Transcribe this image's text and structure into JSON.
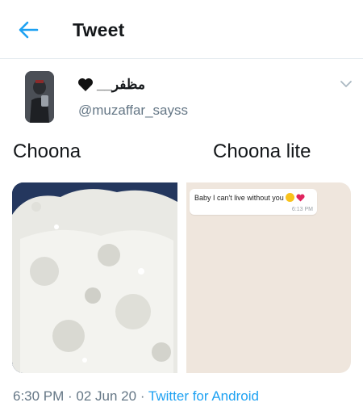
{
  "header": {
    "title": "Tweet"
  },
  "tweet": {
    "display_name": "مظفر__",
    "handle": "@muzaffar_sayss",
    "caption_left": "Choona",
    "caption_right": "Choona lite",
    "chat": {
      "message": "Baby I can't live without you",
      "time": "6:13 PM"
    },
    "meta": {
      "time": "6:30 PM",
      "sep1": " · ",
      "date": "02 Jun 20",
      "sep2": " · ",
      "source": "Twitter for Android"
    }
  },
  "colors": {
    "accent": "#1da1f2",
    "secondary_text": "#657786",
    "divider": "#e6ecf0"
  },
  "icons": [
    "back-arrow-icon",
    "black-heart-icon",
    "chevron-down-icon",
    "kiss-emoji-icon",
    "red-heart-icon"
  ]
}
